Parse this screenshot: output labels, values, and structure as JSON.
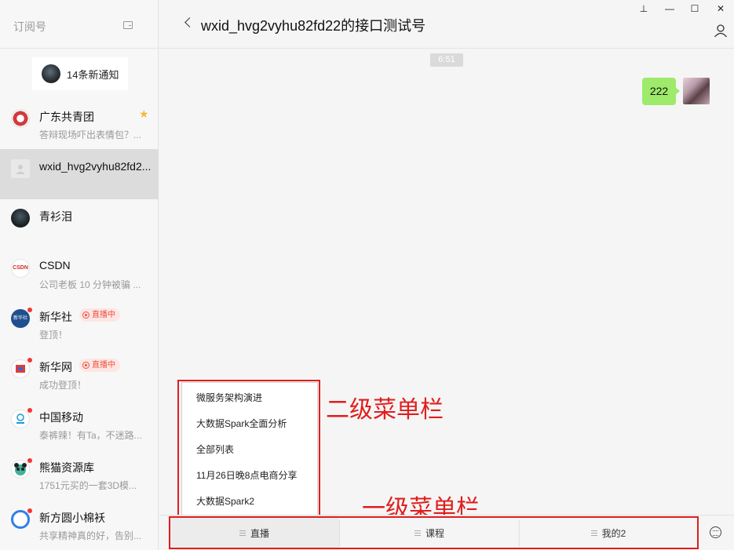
{
  "sidebar": {
    "title": "订阅号",
    "notice": "14条新通知",
    "items": [
      {
        "name": "广东共青团",
        "preview": "答辩现场吓出表情包？..."
      },
      {
        "name": "wxid_hvg2vyhu82fd2...",
        "preview": ""
      },
      {
        "name": "青衫泪",
        "preview": ""
      },
      {
        "name": "CSDN",
        "preview": "公司老板 10 分钟被骗 ..."
      },
      {
        "name": "新华社",
        "preview": "登顶！",
        "badge": "直播中"
      },
      {
        "name": "新华网",
        "preview": "成功登顶！",
        "badge": "直播中"
      },
      {
        "name": "中国移动",
        "preview": "泰裤辣！有Ta，不迷路..."
      },
      {
        "name": "熊猫资源库",
        "preview": "1751元买的一套3D模..."
      },
      {
        "name": "新方圆小棉袄",
        "preview": "共享精神真的好，告别..."
      }
    ],
    "avatar_texts": {
      "csdn": "CSDN",
      "xinhua": "新华社"
    }
  },
  "chat": {
    "title": "wxid_hvg2vyhu82fd22的接口测试号",
    "time": "6:51",
    "message": "222"
  },
  "submenu": {
    "items": [
      "微服务架构演进",
      "大数据Spark全面分析",
      "全部列表",
      "11月26日晚8点电商分享",
      "大数据Spark2"
    ]
  },
  "annotations": {
    "secondary": "二级菜单栏",
    "primary": "一级菜单栏"
  },
  "menubar": {
    "tabs": [
      "直播",
      "课程",
      "我的2"
    ]
  },
  "window": {
    "pin": "⊥",
    "minimize": "—",
    "maximize": "☐",
    "close": "✕"
  },
  "colors": {
    "bubble": "#9eea6a",
    "annotation": "#e01e1e",
    "badge": "#f0503c"
  }
}
